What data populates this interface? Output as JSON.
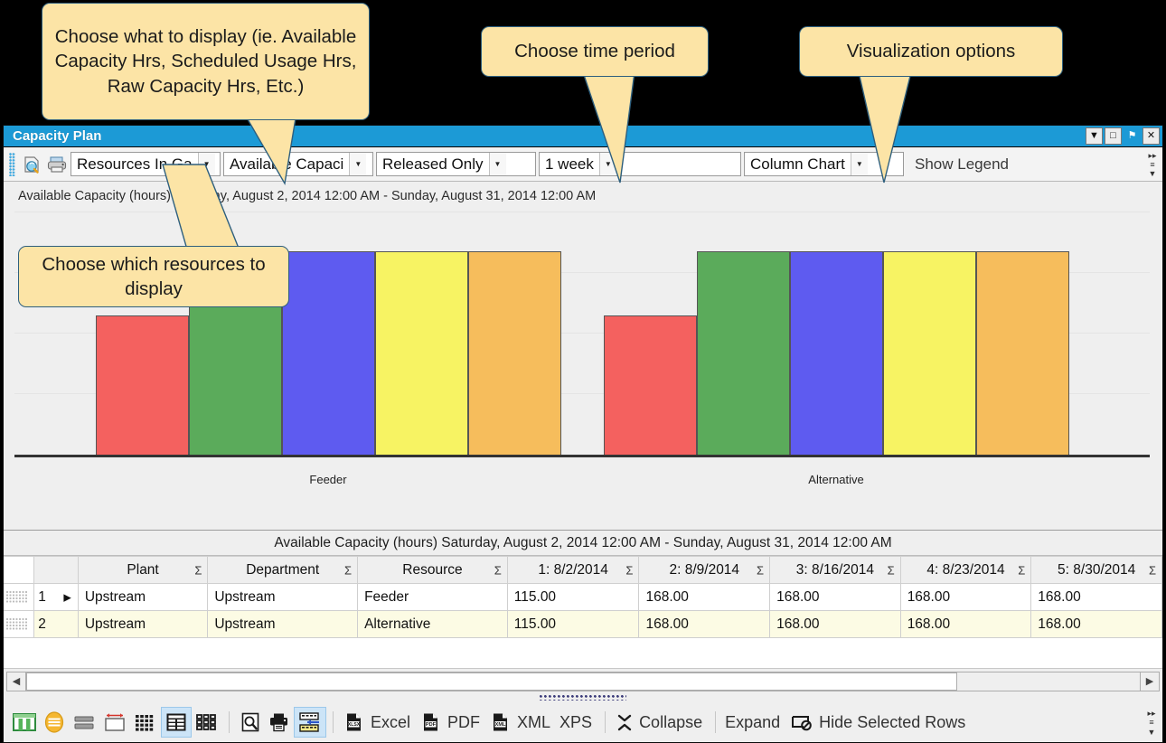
{
  "callouts": [
    {
      "id": "display",
      "text": "Choose what to display (ie. Available Capacity Hrs, Scheduled Usage Hrs, Raw Capacity Hrs, Etc.)"
    },
    {
      "id": "period",
      "text": "Choose time period"
    },
    {
      "id": "viz",
      "text": "Visualization options"
    },
    {
      "id": "res",
      "text": "Choose which resources to display"
    }
  ],
  "window": {
    "title": "Capacity Plan",
    "controls": [
      {
        "name": "dropdown-menu-button",
        "glyph": "▼"
      },
      {
        "name": "maximize-button",
        "glyph": "□"
      },
      {
        "name": "pin-button",
        "glyph": "⚑"
      },
      {
        "name": "close-button",
        "glyph": "✕"
      }
    ]
  },
  "toolbar": {
    "icons": [
      {
        "name": "refresh-query-icon"
      },
      {
        "name": "print-icon"
      }
    ],
    "combos": [
      {
        "name": "resources-combo",
        "value": "Resources In Ga"
      },
      {
        "name": "metric-combo",
        "value": "Available Capaci"
      },
      {
        "name": "filter-combo",
        "value": "Released Only"
      },
      {
        "name": "period-combo",
        "value": "1 week"
      },
      {
        "name": "charttype-combo",
        "value": "Column Chart"
      }
    ],
    "legend_label": "Show Legend",
    "overflow_glyph": "▸▸"
  },
  "chart_data": {
    "type": "bar",
    "title": "Available Capacity (hours) Saturday, August 2, 2014  12:00 AM - Sunday, August 31, 2014  12:00 AM",
    "xlabel": "",
    "ylabel": "",
    "ylim": [
      0,
      200
    ],
    "grid": true,
    "legend": "hidden",
    "categories": [
      "Feeder",
      "Alternative"
    ],
    "series": [
      {
        "name": "1: 8/2/2014",
        "color": "#F4615F",
        "values": [
          115,
          115
        ]
      },
      {
        "name": "2: 8/9/2014",
        "color": "#5BAB5B",
        "values": [
          168,
          168
        ]
      },
      {
        "name": "3: 8/16/2014",
        "color": "#5E5BF0",
        "values": [
          168,
          168
        ]
      },
      {
        "name": "4: 8/23/2014",
        "color": "#F7F363",
        "values": [
          168,
          168
        ]
      },
      {
        "name": "5: 8/30/2014",
        "color": "#F6BD5C",
        "values": [
          168,
          168
        ]
      }
    ]
  },
  "grid": {
    "caption": "Available Capacity (hours) Saturday, August 2, 2014  12:00 AM - Sunday, August 31, 2014  12:00 AM",
    "columns": [
      {
        "label": "Plant",
        "sigma": "Σ",
        "width": 136
      },
      {
        "label": "Department",
        "sigma": "Σ",
        "width": 157
      },
      {
        "label": "Resource",
        "sigma": "Σ",
        "width": 157
      },
      {
        "label": "1: 8/2/2014",
        "sigma": "Σ",
        "width": 138
      },
      {
        "label": "2: 8/9/2014",
        "sigma": "Σ",
        "width": 137
      },
      {
        "label": "3: 8/16/2014",
        "sigma": "Σ",
        "width": 137
      },
      {
        "label": "4: 8/23/2014",
        "sigma": "Σ",
        "width": 137
      },
      {
        "label": "5: 8/30/2014",
        "sigma": "Σ",
        "width": 137
      }
    ],
    "rows": [
      {
        "num": "1",
        "current": "▶",
        "cells": [
          "Upstream",
          "Upstream",
          "Feeder",
          "115.00",
          "168.00",
          "168.00",
          "168.00",
          "168.00"
        ]
      },
      {
        "num": "2",
        "current": "",
        "cells": [
          "Upstream",
          "Upstream",
          "Alternative",
          "115.00",
          "168.00",
          "168.00",
          "168.00",
          "168.00"
        ]
      }
    ]
  },
  "scrollbar": {
    "left_glyph": "◀",
    "right_glyph": "▶"
  },
  "bottom_bar": {
    "items": [
      {
        "name": "layout-grid-icon",
        "label": "",
        "selected": false
      },
      {
        "name": "record-card-icon",
        "label": "",
        "selected": false
      },
      {
        "name": "row-bands-icon",
        "label": "",
        "selected": false
      },
      {
        "name": "autofit-width-icon",
        "label": "",
        "selected": false
      },
      {
        "name": "grid-dense-icon",
        "label": "",
        "selected": false
      },
      {
        "name": "grid-rows-icon",
        "label": "",
        "selected": true
      },
      {
        "name": "card-tiles-icon",
        "label": "",
        "selected": false
      },
      {
        "name": "print-preview-icon",
        "label": "",
        "selected": false
      },
      {
        "name": "print-icon",
        "label": "",
        "selected": false
      },
      {
        "name": "page-setup-icon",
        "label": "",
        "selected": true
      },
      {
        "name": "export-excel-icon",
        "label": "Excel",
        "selected": false
      },
      {
        "name": "export-pdf-icon",
        "label": "PDF",
        "selected": false
      },
      {
        "name": "export-xml-icon",
        "label": "XML",
        "selected": false
      },
      {
        "name": "export-xps-label",
        "label": "XPS",
        "selected": false
      },
      {
        "name": "collapse-icon",
        "label": "Collapse",
        "selected": false
      },
      {
        "name": "expand-label",
        "label": "Expand",
        "selected": false
      },
      {
        "name": "hide-selected-rows-icon",
        "label": "Hide Selected Rows",
        "selected": false
      }
    ],
    "overflow_glyph": "▸▸"
  },
  "colors": {
    "titlebar": "#1C9AD6",
    "callout_fill": "#FCE4A6",
    "callout_border": "#2E5F7E",
    "alt_row": "#FCFBE4",
    "selection": "#CCE4F7"
  }
}
